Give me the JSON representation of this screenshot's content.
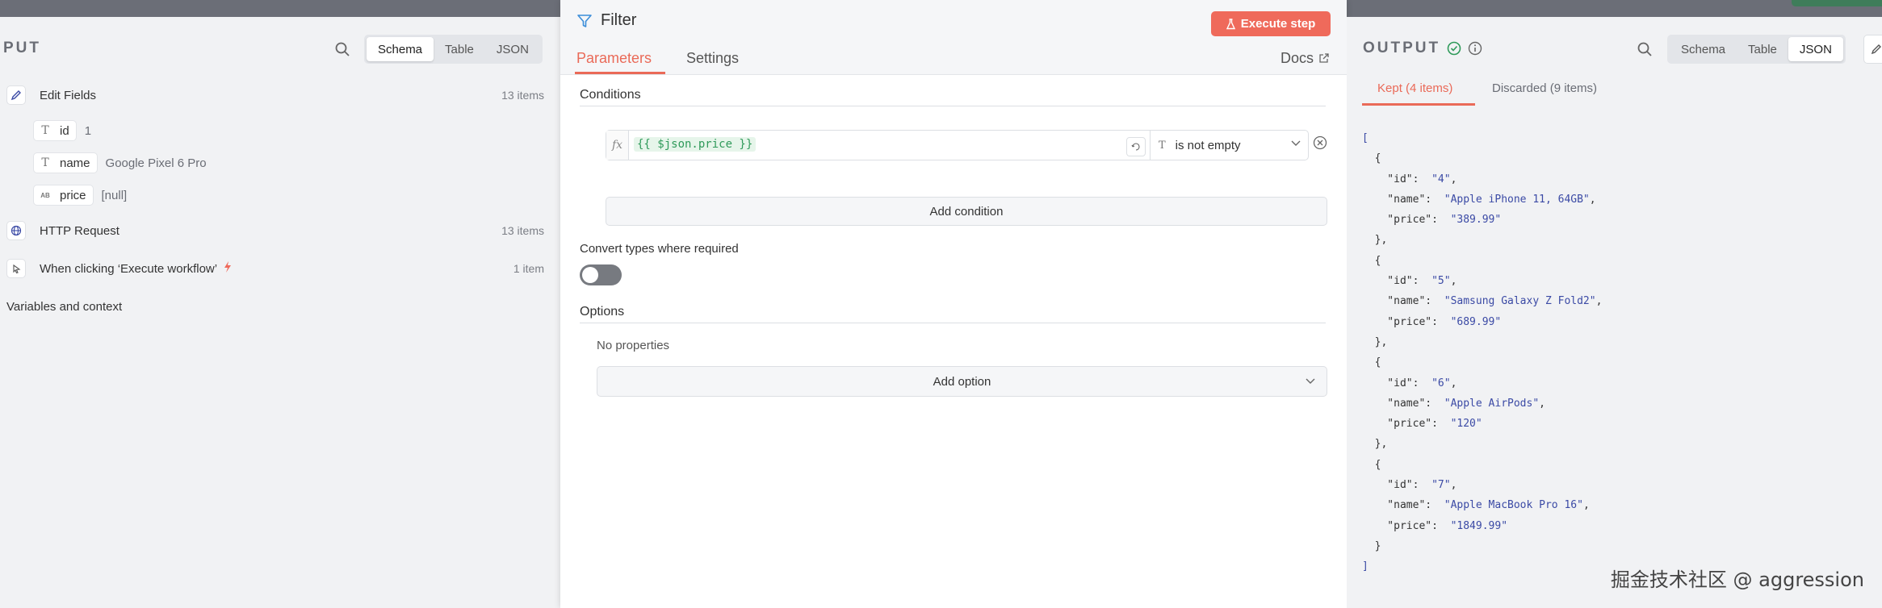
{
  "input_panel": {
    "title": "PUT",
    "view_tabs": [
      "Schema",
      "Table",
      "JSON"
    ],
    "active_view": "Schema",
    "nodes": {
      "edit_fields": {
        "label": "Edit Fields",
        "count": "13 items"
      },
      "http_request": {
        "label": "HTTP Request",
        "count": "13 items"
      },
      "manual_trigger": {
        "label": "When clicking ‘Execute workflow’",
        "count": "1 item"
      }
    },
    "fields": [
      {
        "name": "id",
        "type_icon": "T",
        "value": "1"
      },
      {
        "name": "name",
        "type_icon": "T",
        "value": "Google Pixel 6 Pro"
      },
      {
        "name": "price",
        "type_icon": "AB",
        "value": "[null]"
      }
    ],
    "variables_label": "Variables and context"
  },
  "filter_panel": {
    "title": "Filter",
    "execute_label": "Execute step",
    "tabs": [
      "Parameters",
      "Settings"
    ],
    "active_tab": "Parameters",
    "docs_label": "Docs",
    "conditions_title": "Conditions",
    "condition": {
      "fx_label": "fx",
      "expression": "{{ $json.price }}",
      "operator": "is not empty",
      "operator_type_icon": "T"
    },
    "add_condition_label": "Add condition",
    "convert_types_label": "Convert types where required",
    "convert_types_enabled": false,
    "options_title": "Options",
    "no_properties_label": "No properties",
    "add_option_label": "Add option"
  },
  "output_panel": {
    "title": "OUTPUT",
    "view_tabs": [
      "Schema",
      "Table",
      "JSON"
    ],
    "active_view": "JSON",
    "result_tabs": [
      "Kept (4 items)",
      "Discarded (9 items)"
    ],
    "active_result_tab": "Kept (4 items)",
    "items": [
      {
        "id": "4",
        "name": "Apple iPhone 11, 64GB",
        "price": "389.99"
      },
      {
        "id": "5",
        "name": "Samsung Galaxy Z Fold2",
        "price": "689.99"
      },
      {
        "id": "6",
        "name": "Apple AirPods",
        "price": "120"
      },
      {
        "id": "7",
        "name": "Apple MacBook Pro 16",
        "price": "1849.99"
      }
    ]
  },
  "watermark": "掘金技术社区 @ aggression",
  "colors": {
    "accent": "#ea6a58",
    "execute_button": "#ef6a5b",
    "success": "#2f9a5a",
    "json_value": "#3b4aa5"
  }
}
